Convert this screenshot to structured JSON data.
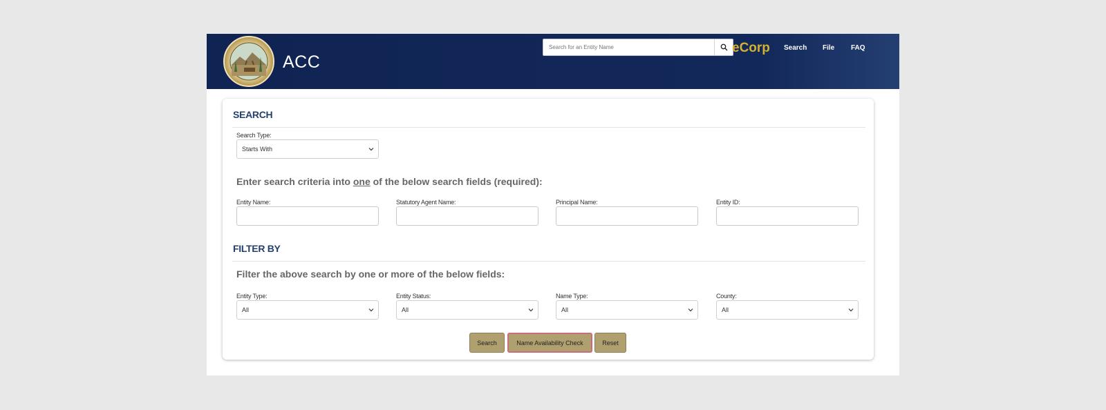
{
  "header": {
    "brand": "ACC",
    "search_placeholder": "Search for an Entity Name",
    "ecorp": "eCorp",
    "nav": [
      "Search",
      "File",
      "FAQ"
    ]
  },
  "search_section": {
    "title": "SEARCH",
    "search_type_label": "Search Type:",
    "search_type_value": "Starts With",
    "instruction_pre": "Enter search criteria into ",
    "instruction_emph": "one",
    "instruction_post": " of the below search fields (required):",
    "fields": [
      {
        "label": "Entity Name:",
        "value": ""
      },
      {
        "label": "Statutory Agent Name:",
        "value": ""
      },
      {
        "label": "Principal Name:",
        "value": ""
      },
      {
        "label": "Entity ID:",
        "value": ""
      }
    ]
  },
  "filter_section": {
    "title": "FILTER BY",
    "instruction": "Filter the above search by one or more of the below fields:",
    "filters": [
      {
        "label": "Entity Type:",
        "value": "All"
      },
      {
        "label": "Entity Status:",
        "value": "All"
      },
      {
        "label": "Name Type:",
        "value": "All"
      },
      {
        "label": "County:",
        "value": "All"
      }
    ]
  },
  "buttons": {
    "search": "Search",
    "name_check": "Name Availability Check",
    "reset": "Reset"
  },
  "colors": {
    "header_bg": "#13285a",
    "accent_gold": "#d6b12c",
    "section_title": "#233f6b",
    "button_bg": "#b1a06f",
    "button_highlight_border": "#c76d7c"
  },
  "icons": {
    "header_search": "search-icon",
    "select_chevron": "chevron-down-icon",
    "seal": "state-seal-logo"
  }
}
